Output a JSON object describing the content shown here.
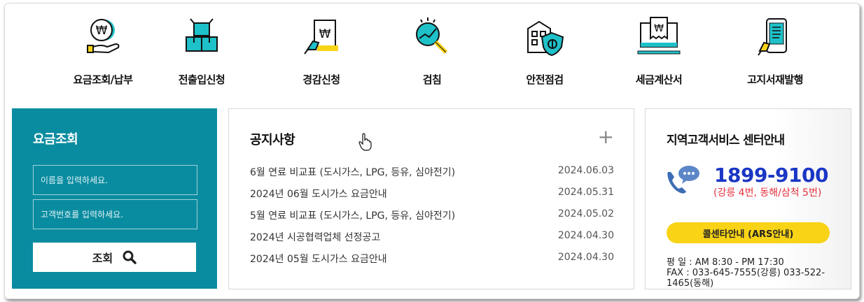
{
  "menu": [
    {
      "label": "요금조회/납부",
      "icon": "won-coin-hand-icon"
    },
    {
      "label": "전출입신청",
      "icon": "boxes-icon"
    },
    {
      "label": "경감신청",
      "icon": "won-document-hand-icon"
    },
    {
      "label": "검침",
      "icon": "meter-magnifier-icon"
    },
    {
      "label": "안전점검",
      "icon": "building-shield-icon"
    },
    {
      "label": "세금계산서",
      "icon": "monitor-receipt-icon"
    },
    {
      "label": "고지서재발행",
      "icon": "phone-bill-icon"
    }
  ],
  "fee": {
    "title": "요금조회",
    "name_placeholder": "이름을 입력하세요.",
    "customer_placeholder": "고객번호를 입력하세요.",
    "search_label": "조회"
  },
  "notice": {
    "title": "공지사항",
    "more": "+",
    "items": [
      {
        "title": "6월 연료 비교표 (도시가스, LPG, 등유, 심야전기)",
        "date": "2024.06.03"
      },
      {
        "title": "2024년 06월 도시가스 요금안내",
        "date": "2024.05.31"
      },
      {
        "title": "5월 연료 비교표 (도시가스, LPG, 등유, 심야전기)",
        "date": "2024.05.02"
      },
      {
        "title": "2024년 시공협력업체 선정공고",
        "date": "2024.04.30"
      },
      {
        "title": "2024년 05월 도시가스 요금안내",
        "date": "2024.04.30"
      }
    ]
  },
  "center": {
    "title": "지역고객서비스 센터안내",
    "phone": "1899-9100",
    "phone_sub": "(강릉 4번, 동해/삼척 5번)",
    "call_button": "콜센타안내 (ARS안내)",
    "hours": "평 일 : AM 8:30 - PM 17:30",
    "fax": "FAX : 033-645-7555(강릉) 033-522-1465(동해)"
  },
  "colors": {
    "teal": "#0a8ca0",
    "accent_cyan": "#1fc1c9",
    "yellow": "#f8d316",
    "blue": "#1a37c4",
    "red": "#e5303c"
  }
}
